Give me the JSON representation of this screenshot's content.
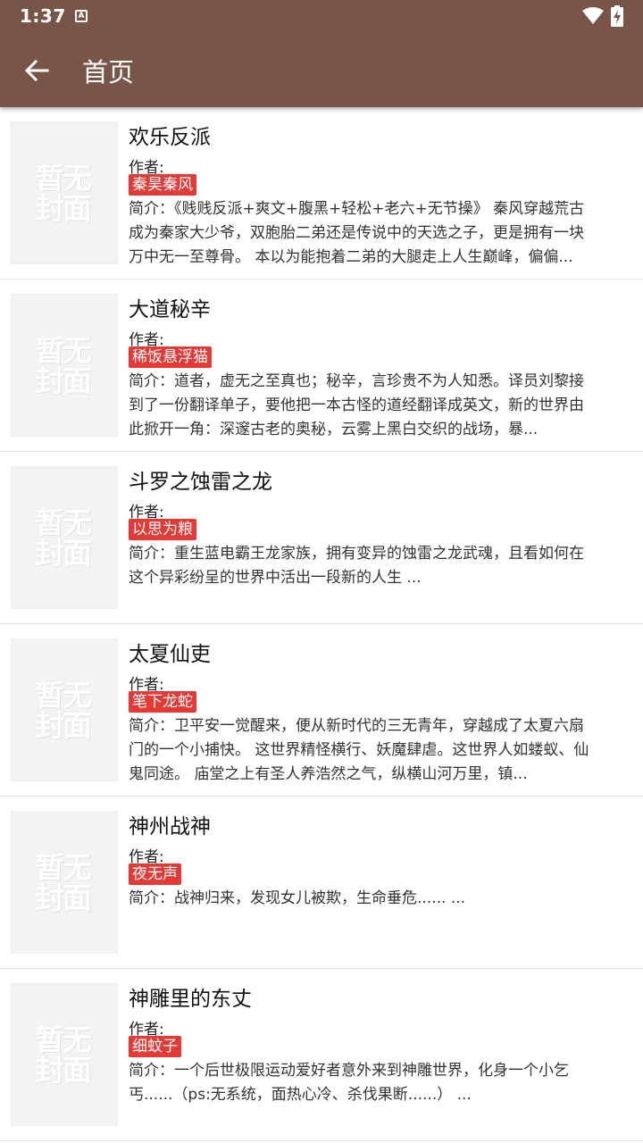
{
  "status": {
    "time": "1:37",
    "notif_letter": "A"
  },
  "toolbar": {
    "title": "首页"
  },
  "author_prefix": "作者:",
  "books": [
    {
      "cover": "暂无封面",
      "title": "欢乐反派",
      "author": "秦昊秦风",
      "intro": "简介：《贱贱反派+爽文+腹黑+轻松+老六+无节操》 秦风穿越荒古成为秦家大少爷，双胞胎二弟还是传说中的天选之子，更是拥有一块万中无一至尊骨。 本以为能抱着二弟的大腿走上人生巅峰，偏偏..."
    },
    {
      "cover": "暂无封面",
      "title": "大道秘辛",
      "author": "稀饭悬浮猫",
      "intro": "简介：道者，虚无之至真也；秘辛，言珍贵不为人知悉。译员刘黎接到了一份翻译单子，要他把一本古怪的道经翻译成英文，新的世界由此掀开一角：深邃古老的奥秘，云雾上黑白交织的战场，暴..."
    },
    {
      "cover": "暂无封面",
      "title": "斗罗之蚀雷之龙",
      "author": "以思为粮",
      "intro": "简介：重生蓝电霸王龙家族，拥有变异的蚀雷之龙武魂，且看如何在这个异彩纷呈的世界中活出一段新的人生 ..."
    },
    {
      "cover": "暂无封面",
      "title": "太夏仙吏",
      "author": "笔下龙蛇",
      "intro": "简介：卫平安一觉醒来，便从新时代的三无青年，穿越成了太夏六扇门的一个小捕快。 这世界精怪横行、妖魔肆虐。这世界人如蝼蚁、仙鬼同途。 庙堂之上有圣人养浩然之气，纵横山河万里，镇..."
    },
    {
      "cover": "暂无封面",
      "title": "神州战神",
      "author": "夜无声",
      "intro": "简介：战神归来，发现女儿被欺，生命垂危...... ..."
    },
    {
      "cover": "暂无封面",
      "title": "神雕里的东丈",
      "author": "细蚊子",
      "intro": "简介：一个后世极限运动爱好者意外来到神雕世界，化身一个小乞丐......（ps:无系统，面热心冷、杀伐果断......） ..."
    }
  ]
}
